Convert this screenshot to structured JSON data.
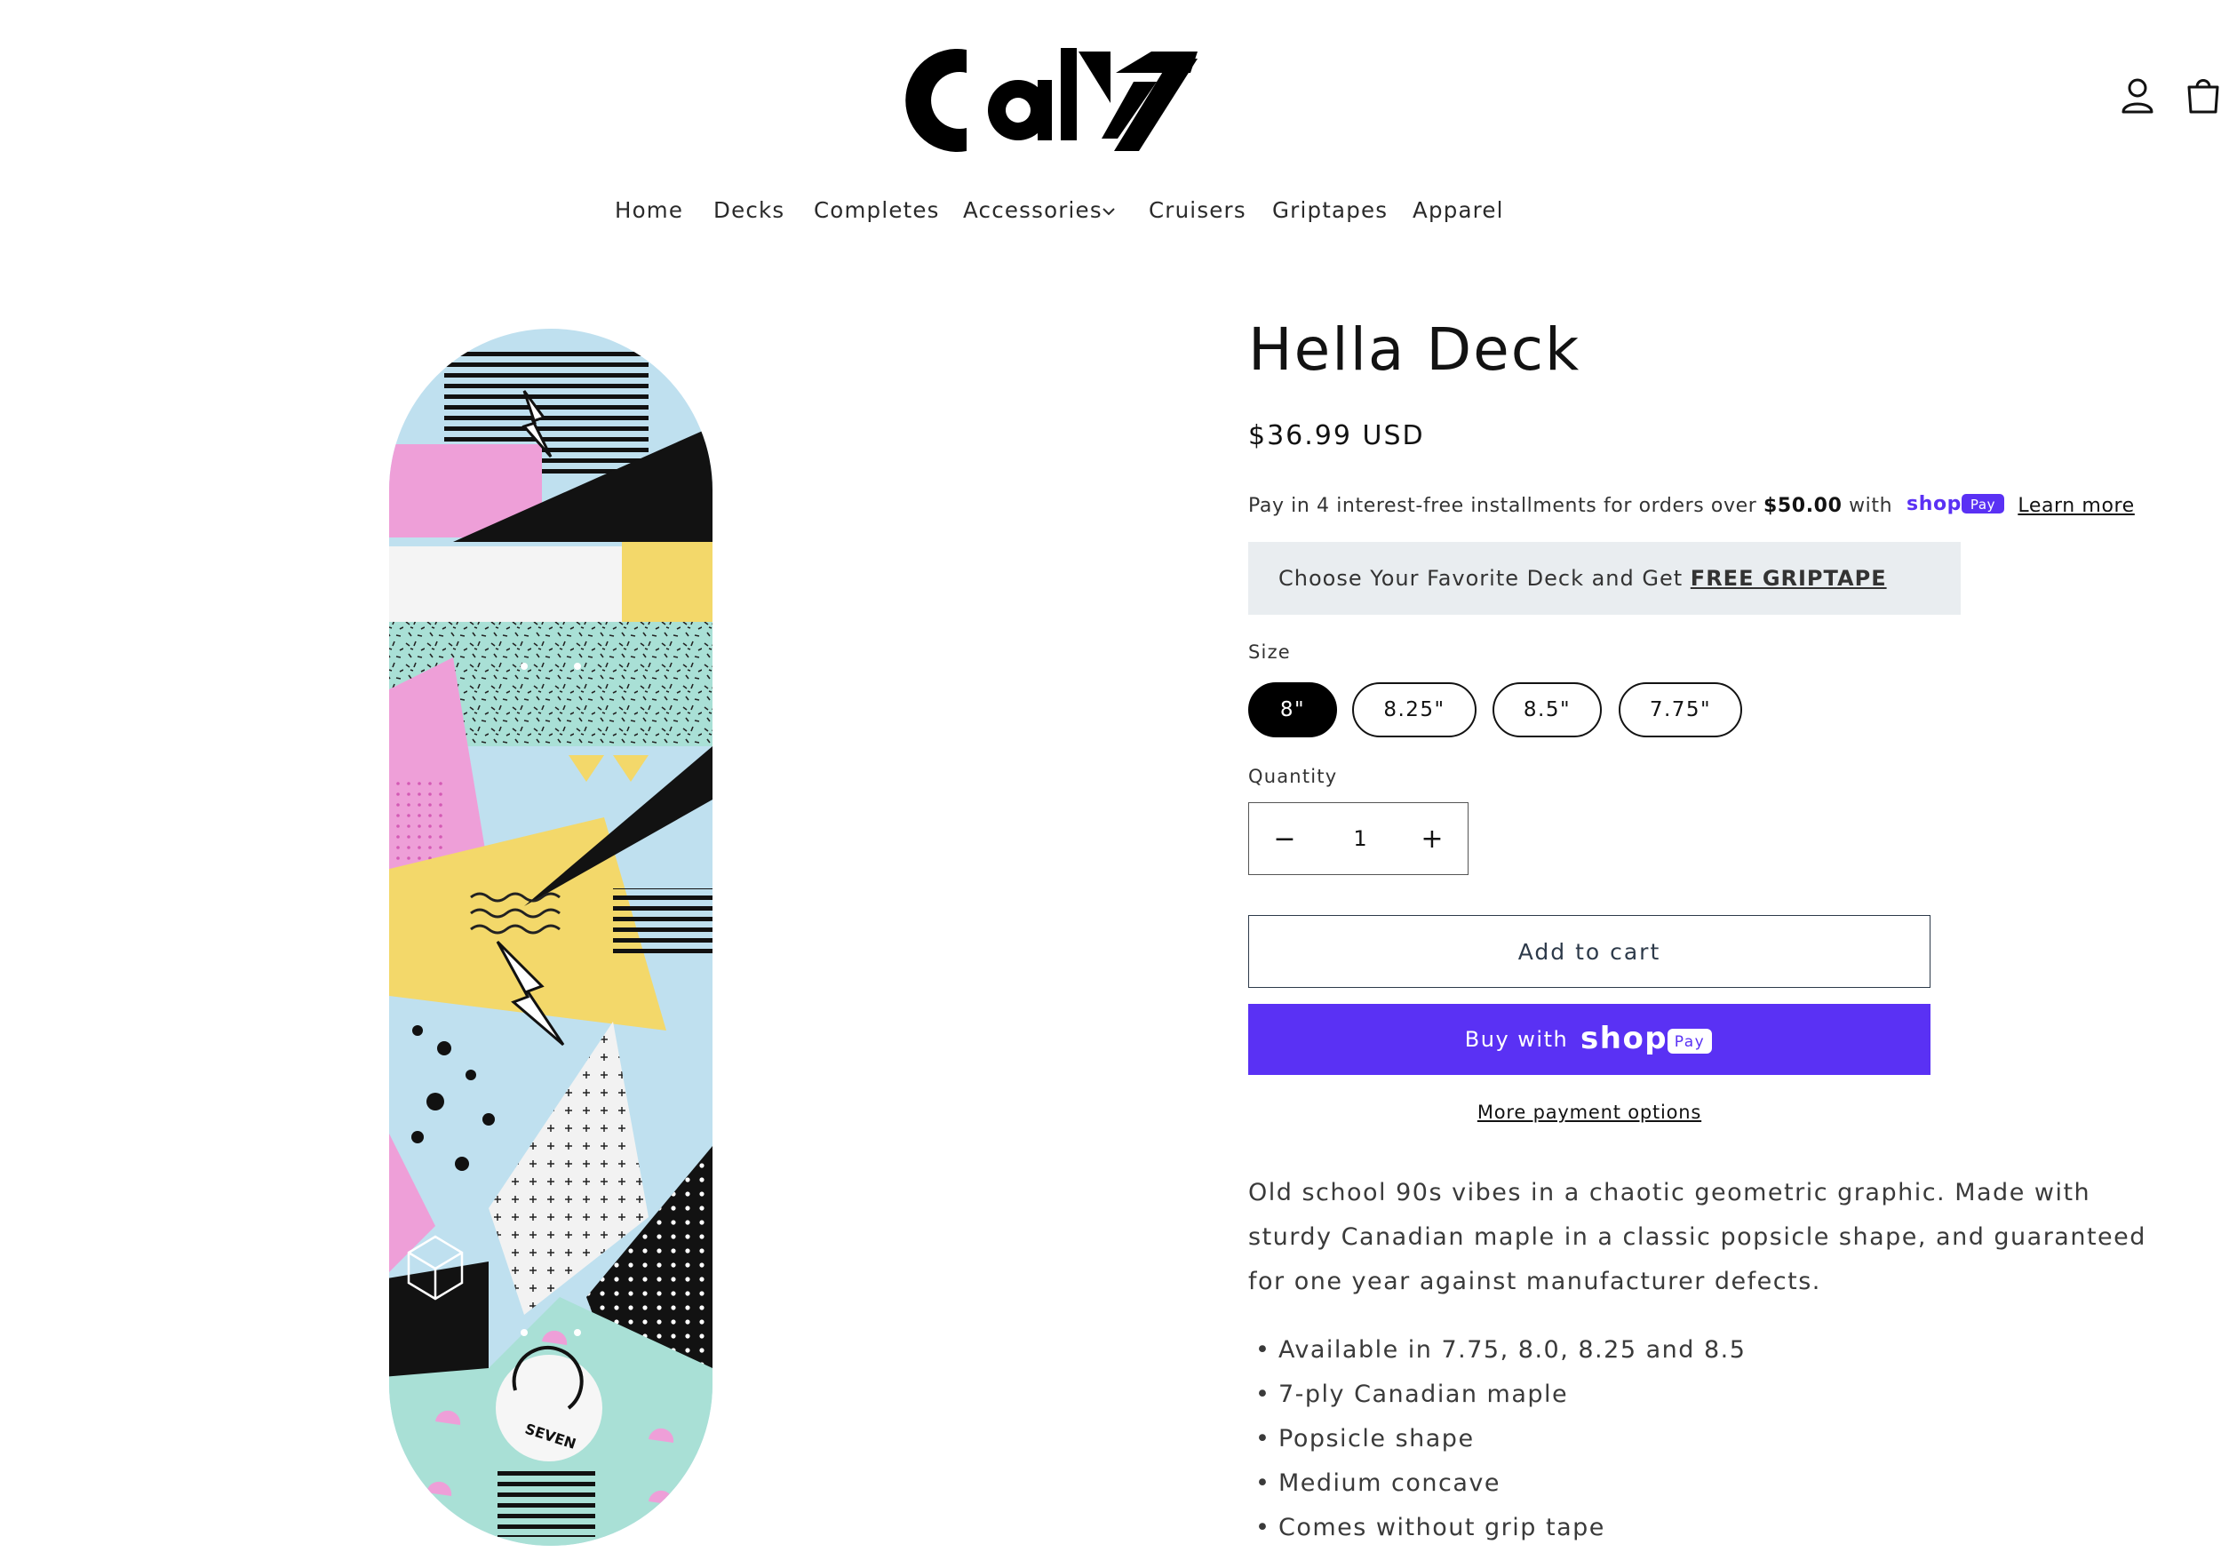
{
  "brand": {
    "logo_text": "Cal7"
  },
  "header": {
    "icons": [
      "account-icon",
      "cart-icon"
    ]
  },
  "nav": {
    "items": [
      {
        "label": "Home"
      },
      {
        "label": "Decks"
      },
      {
        "label": "Completes"
      },
      {
        "label": "Accessories"
      },
      {
        "label": "Cruisers"
      },
      {
        "label": "Griptapes"
      },
      {
        "label": "Apparel"
      }
    ]
  },
  "product": {
    "title": "Hella Deck",
    "price": "$36.99 USD",
    "installments": {
      "prefix": "Pay in 4 interest-free installments for orders over",
      "amount": "$50.00",
      "with": "with",
      "shop_word": "shop",
      "pay_word": "Pay",
      "learn_more": "Learn more"
    },
    "promo": {
      "text": "Choose Your Favorite Deck and Get",
      "link": "FREE GRIPTAPE"
    },
    "size_label": "Size",
    "sizes": [
      {
        "label": "8\"",
        "selected": true
      },
      {
        "label": "8.25\"",
        "selected": false
      },
      {
        "label": "8.5\"",
        "selected": false
      },
      {
        "label": "7.75\"",
        "selected": false
      }
    ],
    "quantity_label": "Quantity",
    "quantity": "1",
    "decrease_symbol": "−",
    "increase_symbol": "+",
    "add_to_cart": "Add to cart",
    "buy_with": "Buy with",
    "shop_word": "shop",
    "pay_word": "Pay",
    "more_payment": "More payment options",
    "description": "Old school 90s vibes in a chaotic geometric graphic. Made with sturdy Canadian maple in a classic popsicle shape, and guaranteed for one year against manufacturer defects.",
    "features": [
      "Available in 7.75, 8.0, 8.25 and 8.5",
      "7-ply Canadian maple",
      "Popsicle shape",
      "Medium concave",
      "Comes without grip tape"
    ],
    "deck_logo_text": "SEVEN"
  },
  "colors": {
    "accent_shoppay": "#5a31f4",
    "promo_bg": "#e9edf0",
    "deck_blue": "#bfe0ef",
    "deck_pink": "#ee9fd8",
    "deck_yellow": "#f3d86a",
    "deck_mint": "#a9e0d6"
  }
}
